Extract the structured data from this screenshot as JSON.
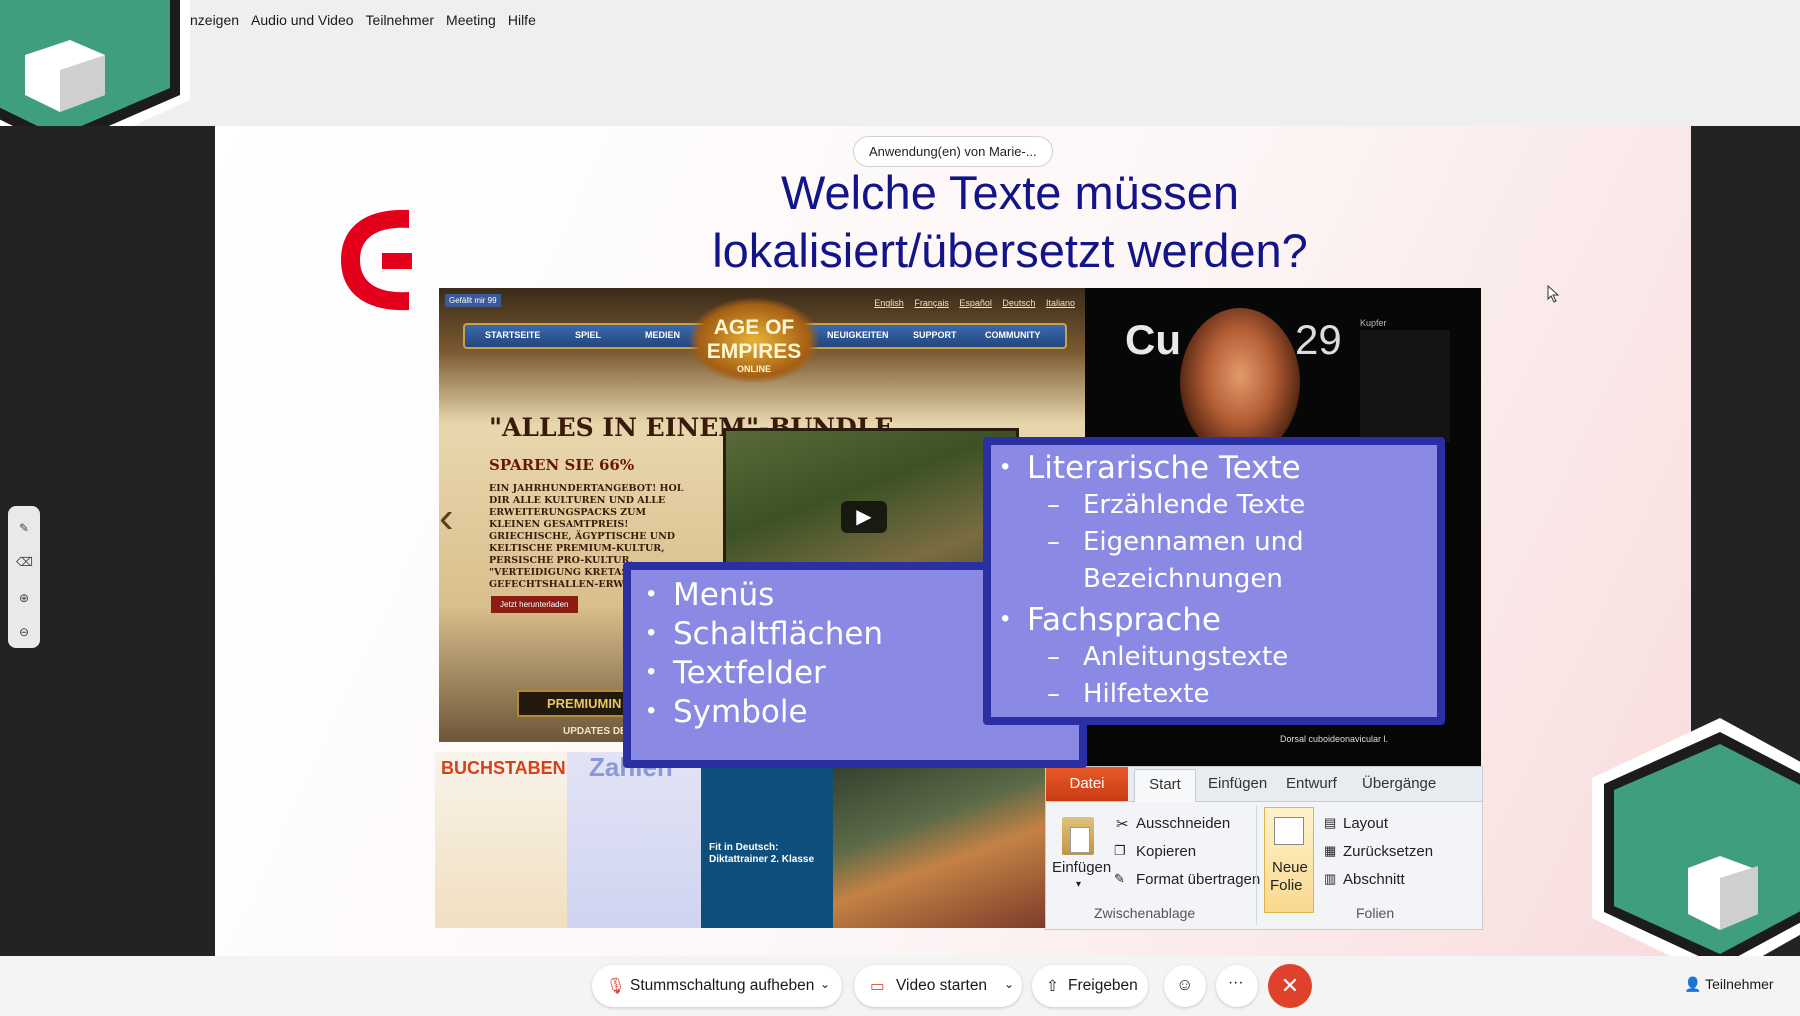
{
  "menu": [
    "nzeigen",
    "Audio und Video",
    "Teilnehmer",
    "Meeting",
    "Hilfe"
  ],
  "share_badge": "Anwendung(en) von Marie-...",
  "slide": {
    "title_line1": "Welche Texte müssen",
    "title_line2": "lokalisiert/übersetzt werden?"
  },
  "aoe": {
    "logo": "AGE OF EMPIRES",
    "logo_sub": "ONLINE",
    "nav": [
      "STARTSEITE",
      "SPIEL",
      "MEDIEN",
      "NEUIGKEITEN",
      "SUPPORT",
      "COMMUNITY"
    ],
    "langs": [
      "English",
      "Français",
      "Español",
      "Deutsch",
      "Italiano"
    ],
    "like": "Gefällt mir 99",
    "bundle": "\"ALLES IN EINEM\"-BUNDLE",
    "sparen": "SPAREN SIE 66%",
    "body": "EIN JAHRHUNDERTANGEBOT! HOL DIR ALLE KULTUREN UND ALLE ERWEITERUNGSPACKS ZUM KLEINEN GESAMTPREIS! GRIECHISCHE, ÄGYPTISCHE UND KELTISCHE PREMIUM-KULTUR, PERSISCHE PRO-KULTUR, \"VERTEIDIGUNG KRETAS\"- UND GEFECHTSHALLEN-ERWEITERUNG",
    "download": "Jetzt herunterladen",
    "premium": "PREMIUMIN",
    "updates": "UPDATES DE"
  },
  "cu": {
    "symbol": "Cu",
    "number": "29",
    "label": "Kupfer",
    "caption": "Dorsal cuboideonavicular l."
  },
  "kids": {
    "k1": "BUCHSTABEN",
    "k2": "Zahlen",
    "k3": "Fit in Deutsch: Diktattrainer 2. Klasse"
  },
  "ribbon": {
    "tabs": [
      "Datei",
      "Start",
      "Einfügen",
      "Entwurf",
      "Übergänge"
    ],
    "paste": "Einfügen",
    "cut": "Ausschneiden",
    "copy": "Kopieren",
    "format": "Format übertragen",
    "clipboard_group": "Zwischenablage",
    "new_slide_1": "Neue",
    "new_slide_2": "Folie",
    "layout": "Layout",
    "reset": "Zurücksetzen",
    "section": "Abschnitt",
    "slides_group": "Folien"
  },
  "left_box": [
    "Menüs",
    "Schaltflächen",
    "Textfelder",
    "Symbole"
  ],
  "right_box": {
    "h1": "Literarische Texte",
    "h1_items": [
      "Erzählende Texte",
      "Eigennamen und",
      "Bezeichnungen"
    ],
    "h2": "Fachsprache",
    "h2_items": [
      "Anleitungstexte",
      "Hilfetexte"
    ]
  },
  "toolbar": {
    "unmute": "Stummschaltung aufheben",
    "video": "Video starten",
    "share": "Freigeben",
    "participants": "Teilnehmer"
  },
  "colors": {
    "title": "#13148a",
    "box_fill": "#8a8ae4",
    "box_border": "#2b2fa4",
    "end_call": "#e0412a",
    "logo_red": "#e4001b"
  }
}
